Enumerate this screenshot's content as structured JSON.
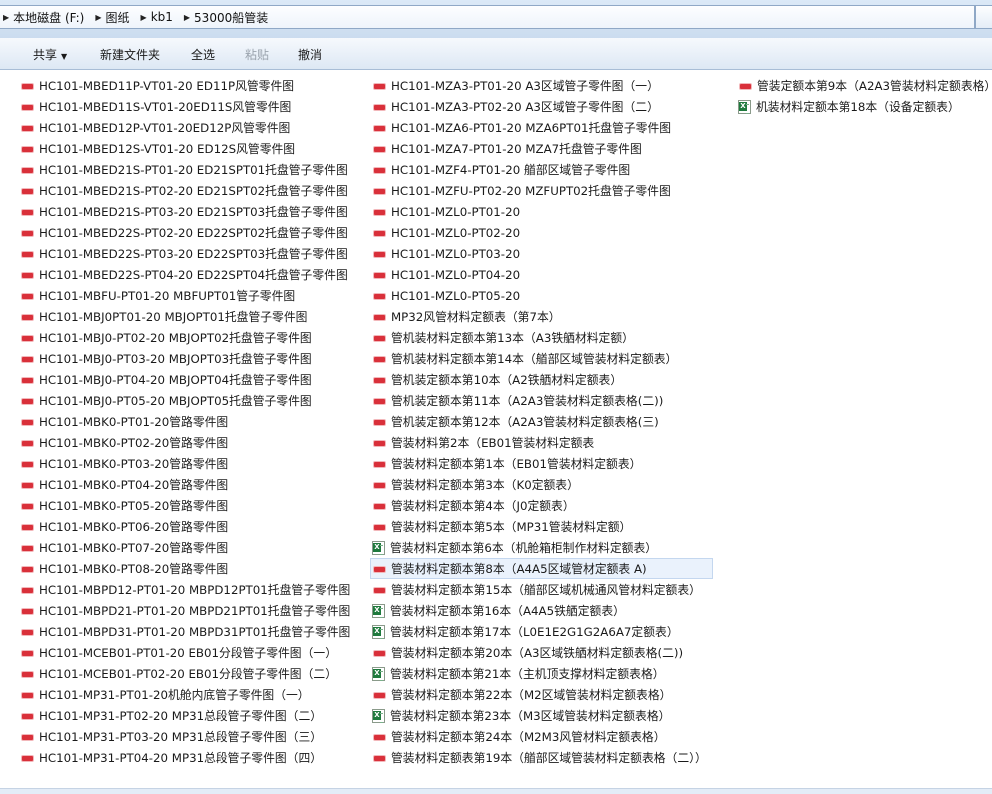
{
  "breadcrumb": [
    "本地磁盘 (F:)",
    "图纸",
    "kb1",
    "53000船管装"
  ],
  "toolbar": {
    "share": "共享",
    "new_folder": "新建文件夹",
    "select_all": "全选",
    "paste": "粘贴",
    "undo": "撤消"
  },
  "columns": [
    [
      {
        "name": "HC101-MBED11P-VT01-20  ED11P风管零件图",
        "type": "pdf"
      },
      {
        "name": "HC101-MBED11S-VT01-20ED11S风管零件图",
        "type": "pdf"
      },
      {
        "name": "HC101-MBED12P-VT01-20ED12P风管零件图",
        "type": "pdf"
      },
      {
        "name": "HC101-MBED12S-VT01-20  ED12S风管零件图",
        "type": "pdf"
      },
      {
        "name": "HC101-MBED21S-PT01-20    ED21SPT01托盘管子零件图",
        "type": "pdf"
      },
      {
        "name": "HC101-MBED21S-PT02-20   ED21SPT02托盘管子零件图",
        "type": "pdf"
      },
      {
        "name": "HC101-MBED21S-PT03-20    ED21SPT03托盘管子零件图",
        "type": "pdf"
      },
      {
        "name": "HC101-MBED22S-PT02-20   ED22SPT02托盘管子零件图",
        "type": "pdf"
      },
      {
        "name": "HC101-MBED22S-PT03-20    ED22SPT03托盘管子零件图",
        "type": "pdf"
      },
      {
        "name": "HC101-MBED22S-PT04-20    ED22SPT04托盘管子零件图",
        "type": "pdf"
      },
      {
        "name": "HC101-MBFU-PT01-20  MBFUPT01管子零件图",
        "type": "pdf"
      },
      {
        "name": "HC101-MBJ0PT01-20  MBJOPT01托盘管子零件图",
        "type": "pdf"
      },
      {
        "name": "HC101-MBJ0-PT02-20 MBJOPT02托盘管子零件图",
        "type": "pdf"
      },
      {
        "name": "HC101-MBJ0-PT03-20 MBJOPT03托盘管子零件图",
        "type": "pdf"
      },
      {
        "name": "HC101-MBJ0-PT04-20 MBJOPT04托盘管子零件图",
        "type": "pdf"
      },
      {
        "name": "HC101-MBJ0-PT05-20 MBJOPT05托盘管子零件图",
        "type": "pdf"
      },
      {
        "name": "HC101-MBK0-PT01-20管路零件图",
        "type": "pdf"
      },
      {
        "name": "HC101-MBK0-PT02-20管路零件图",
        "type": "pdf"
      },
      {
        "name": "HC101-MBK0-PT03-20管路零件图",
        "type": "pdf"
      },
      {
        "name": "HC101-MBK0-PT04-20管路零件图",
        "type": "pdf"
      },
      {
        "name": "HC101-MBK0-PT05-20管路零件图",
        "type": "pdf"
      },
      {
        "name": "HC101-MBK0-PT06-20管路零件图",
        "type": "pdf"
      },
      {
        "name": "HC101-MBK0-PT07-20管路零件图",
        "type": "pdf"
      },
      {
        "name": "HC101-MBK0-PT08-20管路零件图",
        "type": "pdf"
      },
      {
        "name": "HC101-MBPD12-PT01-20  MBPD12PT01托盘管子零件图",
        "type": "pdf"
      },
      {
        "name": "HC101-MBPD21-PT01-20   MBPD21PT01托盘管子零件图",
        "type": "pdf"
      },
      {
        "name": "HC101-MBPD31-PT01-20  MBPD31PT01托盘管子零件图",
        "type": "pdf"
      },
      {
        "name": "HC101-MCEB01-PT01-20    EB01分段管子零件图（一）",
        "type": "pdf"
      },
      {
        "name": "HC101-MCEB01-PT02-20  EB01分段管子零件图（二）",
        "type": "pdf"
      },
      {
        "name": "HC101-MP31-PT01-20机舱内底管子零件图（一）",
        "type": "pdf"
      },
      {
        "name": "HC101-MP31-PT02-20   MP31总段管子零件图（二）",
        "type": "pdf"
      },
      {
        "name": "HC101-MP31-PT03-20 MP31总段管子零件图（三）",
        "type": "pdf"
      },
      {
        "name": "HC101-MP31-PT04-20   MP31总段管子零件图（四）",
        "type": "pdf"
      }
    ],
    [
      {
        "name": "HC101-MZA3-PT01-20   A3区域管子零件图（一）",
        "type": "pdf"
      },
      {
        "name": "HC101-MZA3-PT02-20    A3区域管子零件图（二）",
        "type": "pdf"
      },
      {
        "name": "HC101-MZA6-PT01-20  MZA6PT01托盘管子零件图",
        "type": "pdf"
      },
      {
        "name": "HC101-MZA7-PT01-20   MZA7托盘管子零件图",
        "type": "pdf"
      },
      {
        "name": "HC101-MZF4-PT01-20  艏部区域管子零件图",
        "type": "pdf"
      },
      {
        "name": "HC101-MZFU-PT02-20    MZFUPT02托盘管子零件图",
        "type": "pdf"
      },
      {
        "name": "HC101-MZL0-PT01-20",
        "type": "pdf"
      },
      {
        "name": "HC101-MZL0-PT02-20",
        "type": "pdf"
      },
      {
        "name": "HC101-MZL0-PT03-20",
        "type": "pdf"
      },
      {
        "name": "HC101-MZL0-PT04-20",
        "type": "pdf"
      },
      {
        "name": "HC101-MZL0-PT05-20",
        "type": "pdf"
      },
      {
        "name": "MP32风管材料定额表（第7本）",
        "type": "pdf"
      },
      {
        "name": "管机装材料定额本第13本（A3铁舾材料定额）",
        "type": "pdf"
      },
      {
        "name": "管机装材料定额本第14本（艏部区域管装材料定额表）",
        "type": "pdf"
      },
      {
        "name": "管机装定额本第10本（A2铁舾材料定额表）",
        "type": "pdf"
      },
      {
        "name": "管机装定额本第11本（A2A3管装材料定额表格(二))",
        "type": "pdf"
      },
      {
        "name": "管机装定额本第12本（A2A3管装材料定额表格(三)",
        "type": "pdf"
      },
      {
        "name": "管装材料第2本（EB01管装材料定额表",
        "type": "pdf"
      },
      {
        "name": "管装材料定额本第1本（EB01管装材料定额表）",
        "type": "pdf"
      },
      {
        "name": "管装材料定额本第3本（K0定额表）",
        "type": "pdf"
      },
      {
        "name": "管装材料定额本第4本（J0定额表）",
        "type": "pdf"
      },
      {
        "name": "管装材料定额本第5本（MP31管装材料定额）",
        "type": "pdf"
      },
      {
        "name": "管装材料定额本第6本（机舱箱柜制作材料定额表）",
        "type": "xls"
      },
      {
        "name": "管装材料定额本第8本（A4A5区域管材定额表 A)",
        "type": "pdf",
        "selected": true
      },
      {
        "name": "管装材料定额本第15本（艏部区域机械通风管材料定额表）",
        "type": "pdf"
      },
      {
        "name": "管装材料定额本第16本（A4A5铁舾定额表）",
        "type": "xls"
      },
      {
        "name": "管装材料定额本第17本（L0E1E2G1G2A6A7定额表）",
        "type": "xls"
      },
      {
        "name": "管装材料定额本第20本（A3区域铁舾材料定额表格(二))",
        "type": "pdf"
      },
      {
        "name": "管装材料定额本第21本（主机顶支撑材料定额表格）",
        "type": "xls"
      },
      {
        "name": "管装材料定额本第22本（M2区域管装材料定额表格）",
        "type": "pdf"
      },
      {
        "name": "管装材料定额本第23本（M3区域管装材料定额表格）",
        "type": "xls"
      },
      {
        "name": "管装材料定额本第24本（M2M3风管材料定额表格）",
        "type": "pdf"
      },
      {
        "name": "管装材料定额表第19本（艏部区域管装材料定额表格（二））",
        "type": "pdf"
      }
    ],
    [
      {
        "name": "管装定额本第9本（A2A3管装材料定额表格）",
        "type": "pdf"
      },
      {
        "name": "机装材料定额本第18本（设备定额表）",
        "type": "xls"
      }
    ]
  ]
}
